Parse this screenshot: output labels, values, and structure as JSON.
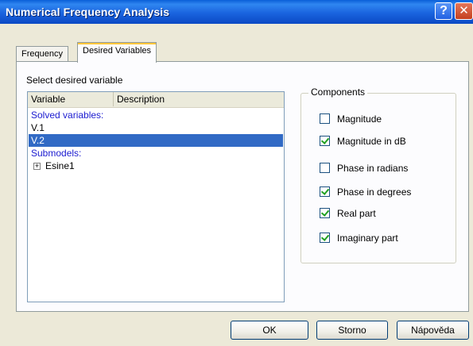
{
  "window": {
    "title": "Numerical Frequency Analysis",
    "help_glyph": "?",
    "close_glyph": "✕"
  },
  "tabs": [
    {
      "label": "Frequency"
    },
    {
      "label": "Desired Variables"
    }
  ],
  "selector": {
    "label": "Select desired variable",
    "columns": [
      "Variable",
      "Description"
    ],
    "rows": [
      {
        "text": "Solved variables:"
      },
      {
        "text": "V.1"
      },
      {
        "text": "V.2"
      },
      {
        "text": "Submodels:"
      },
      {
        "text": "Esine1",
        "expand_glyph": "+"
      }
    ],
    "selected_row": "V.2"
  },
  "components": {
    "legend": "Components",
    "items": [
      {
        "label": "Magnitude",
        "checked": false
      },
      {
        "label": "Magnitude in dB",
        "checked": true
      },
      {
        "label": "Phase in radians",
        "checked": false
      },
      {
        "label": "Phase in degrees",
        "checked": true
      },
      {
        "label": "Real part",
        "checked": true
      },
      {
        "label": "Imaginary part",
        "checked": true
      }
    ]
  },
  "buttons": {
    "ok": "OK",
    "cancel": "Storno",
    "help": "Nápověda"
  },
  "colors": {
    "selection": "#316ac5",
    "group_header_text": "#1b1bd0",
    "title_bar": "#0b49c4"
  }
}
